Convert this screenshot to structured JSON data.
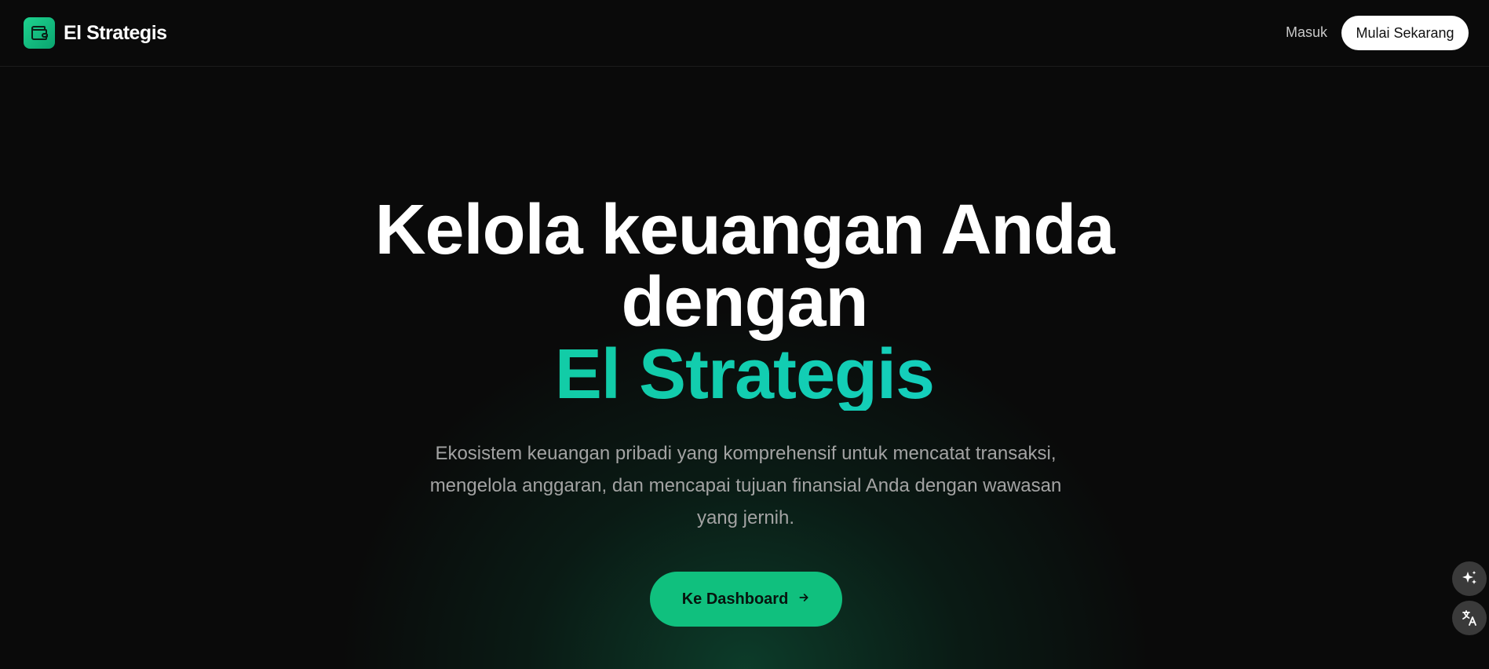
{
  "header": {
    "brand": "El Strategis",
    "logo_icon": "wallet-icon",
    "login_label": "Masuk",
    "cta_label": "Mulai Sekarang"
  },
  "hero": {
    "title_line1": "Kelola keuangan Anda",
    "title_line2": "dengan",
    "title_accent": "El Strategis",
    "subtitle": "Ekosistem keuangan pribadi yang komprehensif untuk mencatat transaksi, mengelola anggaran, dan mencapai tujuan finansial Anda dengan wawasan yang jernih.",
    "cta_label": "Ke Dashboard",
    "cta_icon": "arrow-right-icon"
  },
  "floating": {
    "sparkle_icon": "sparkle-icon",
    "translate_icon": "translate-icon"
  },
  "colors": {
    "background": "#0a0a0a",
    "accent_green": "#10c07e",
    "accent_cyan": "#1ad2de",
    "text_muted": "#a3a3a3"
  }
}
